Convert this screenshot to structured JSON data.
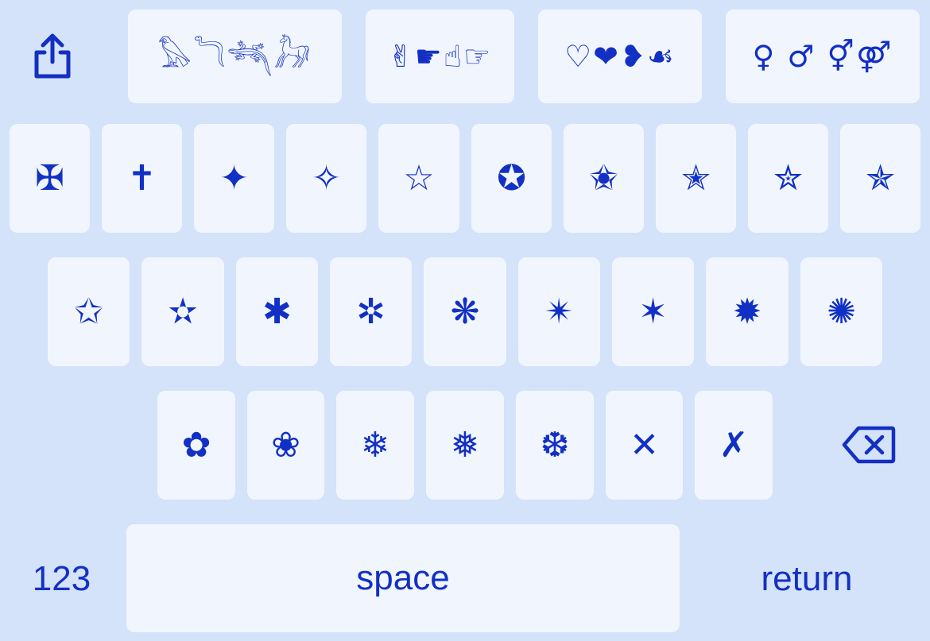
{
  "top_row": {
    "share_icon": "share-icon",
    "categories": [
      {
        "name": "hieroglyphs",
        "glyphs": "𓅃𓆓𓆈𓃗"
      },
      {
        "name": "hands",
        "glyphs": "✌☛☝☞"
      },
      {
        "name": "hearts",
        "glyphs": "♡❤❥☙"
      },
      {
        "name": "gender",
        "glyphs": "♀ ♂ ⚥⚤"
      }
    ]
  },
  "row1": [
    "✠",
    "✝",
    "✦",
    "✧",
    "☆",
    "✪",
    "✬",
    "✭",
    "✮",
    "✯"
  ],
  "row2": [
    "✩",
    "✫",
    "✱",
    "✲",
    "❋",
    "✴",
    "✶",
    "✹",
    "✺"
  ],
  "row3": [
    "✿",
    "❀",
    "❄",
    "❅",
    "❆",
    "✕",
    "✗"
  ],
  "bottom": {
    "numbers_label": "123",
    "space_label": "space",
    "return_label": "return"
  },
  "colors": {
    "background": "#d4e2fa",
    "key": "#f1f6fe",
    "accent": "#1230c4"
  }
}
